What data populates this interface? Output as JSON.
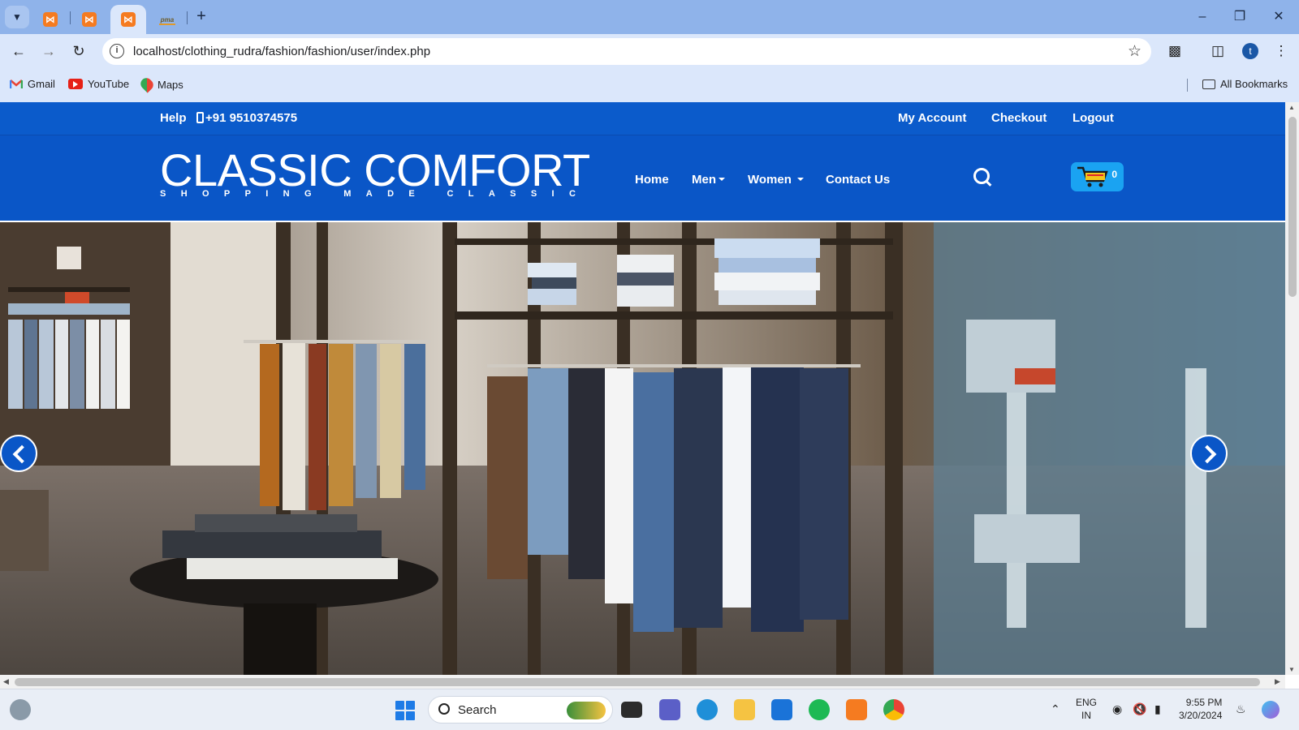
{
  "browser": {
    "address": "localhost/clothing_rudra/fashion/fashion/user/index.php",
    "bookmarks": [
      "Gmail",
      "YouTube",
      "Maps"
    ],
    "all_bookmarks": "All Bookmarks",
    "profile_initial": "t",
    "new_tab": "+"
  },
  "site": {
    "topbar": {
      "help": "Help",
      "phone": "+91 9510374575",
      "my_account": "My Account",
      "checkout": "Checkout",
      "logout": "Logout"
    },
    "logo": "CLASSIC COMFORT",
    "tagline": [
      "S",
      "H",
      "O",
      "P",
      "P",
      "I",
      "N",
      "G",
      " ",
      "M",
      "A",
      "D",
      "E",
      " ",
      "C",
      "L",
      "A",
      "S",
      "S",
      "I",
      "C"
    ],
    "nav": {
      "home": "Home",
      "men": "Men",
      "women": "Women",
      "contact": "Contact Us"
    },
    "cart_count": "0",
    "colors": {
      "primary": "#0a56c7",
      "cart": "#1aa3f2"
    }
  },
  "taskbar": {
    "search": "Search",
    "lang": "ENG",
    "region": "IN",
    "time": "9:55 PM",
    "date": "3/20/2024"
  }
}
